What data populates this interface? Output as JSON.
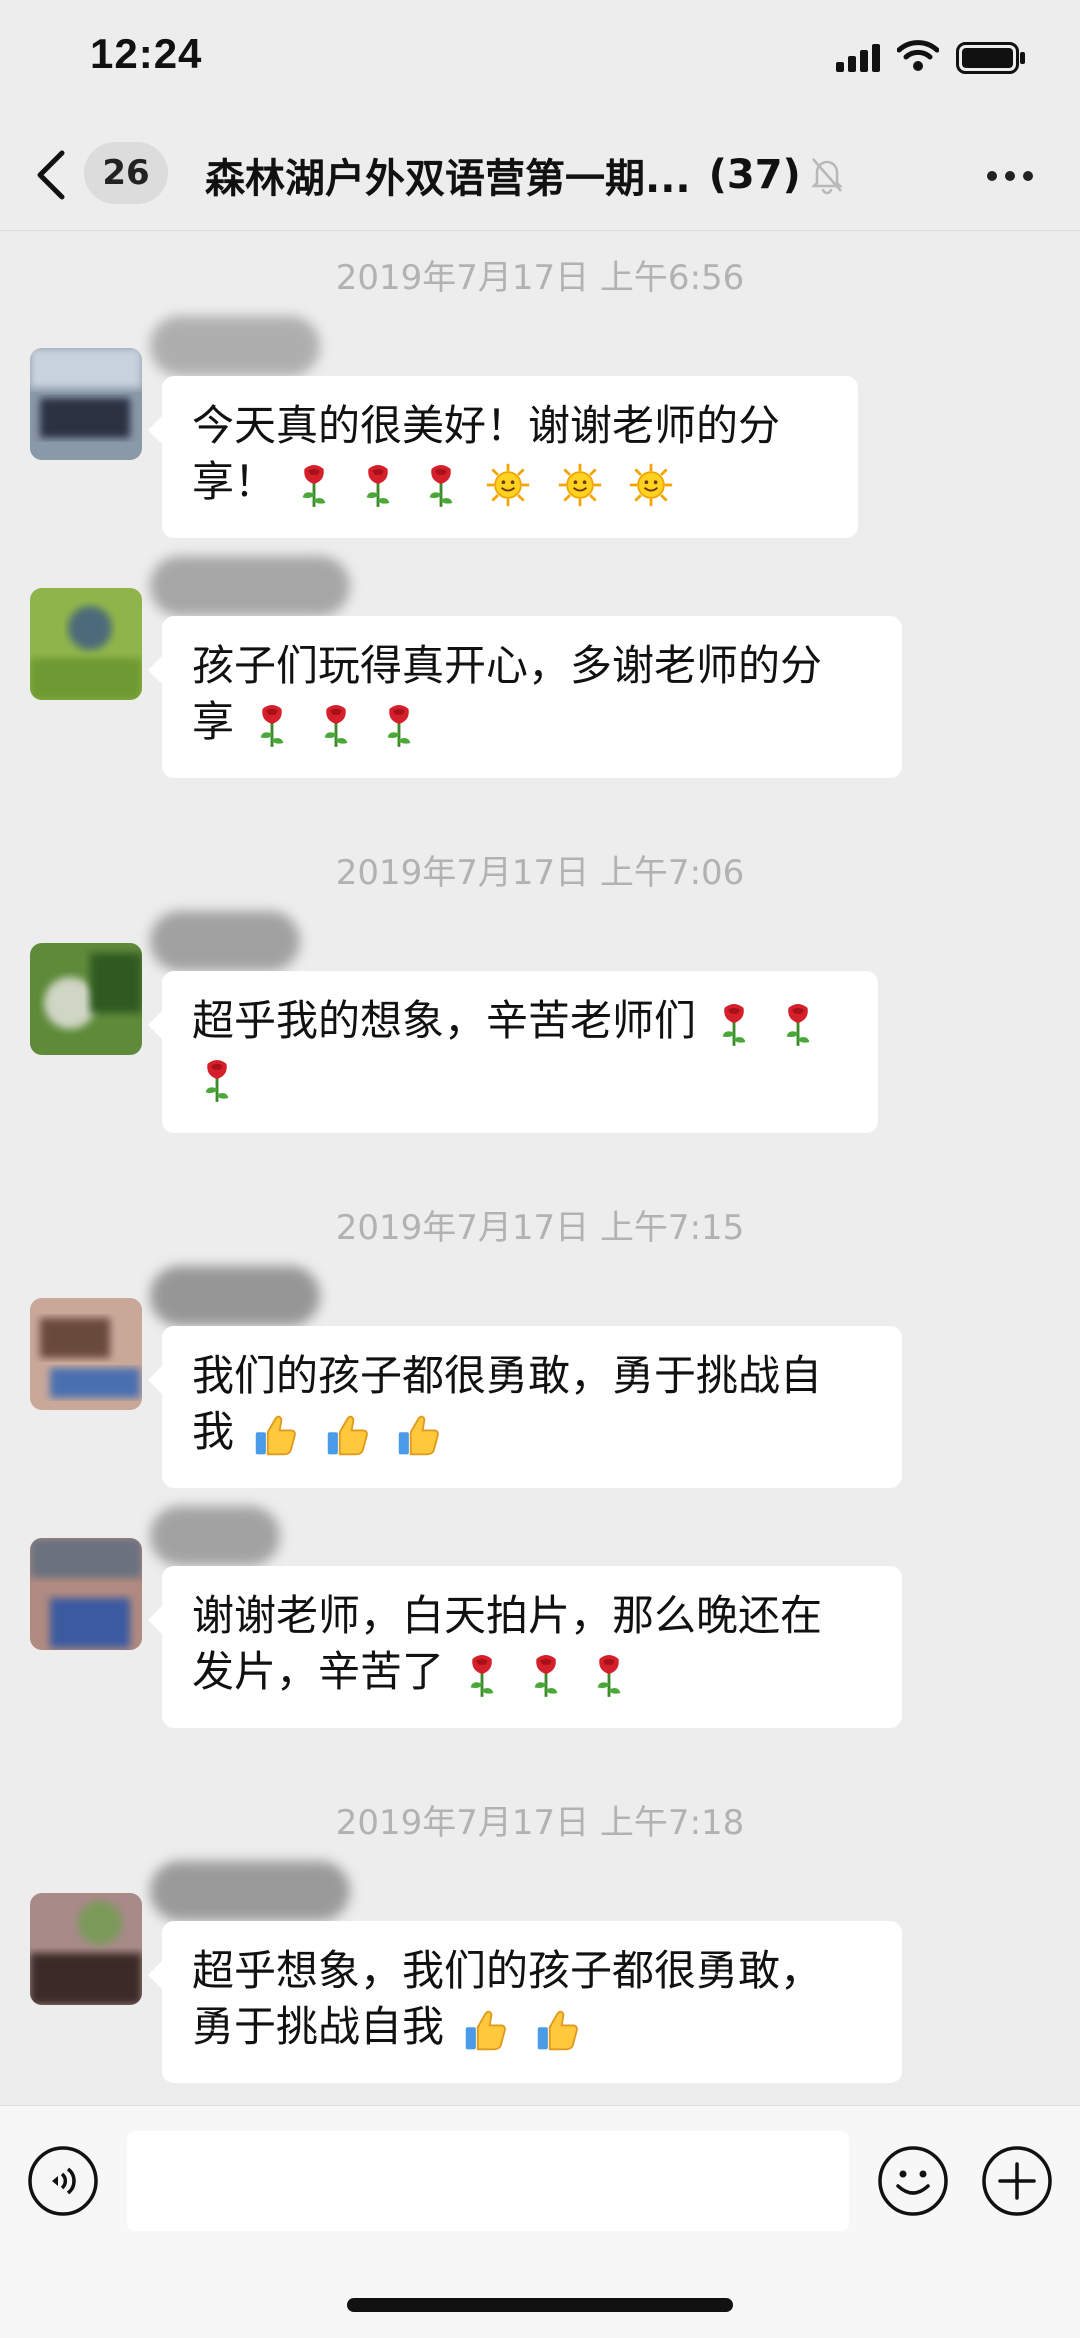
{
  "status_bar": {
    "time": "12:24"
  },
  "nav": {
    "unread_count": "26",
    "title": "森林湖户外双语营第一期...",
    "member_count": "(37)"
  },
  "timestamps": [
    "2019年7月17日 上午6:56",
    "2019年7月17日 上午7:06",
    "2019年7月17日 上午7:15",
    "2019年7月17日 上午7:18"
  ],
  "messages": [
    {
      "line1": "今天真的很美好！谢谢老师的分",
      "line2": "享！",
      "emojis": [
        "rose",
        "rose",
        "rose",
        "sun",
        "sun",
        "sun"
      ]
    },
    {
      "line1": "孩子们玩得真开心，多谢老师的分",
      "line2": "享",
      "emojis": [
        "rose",
        "rose",
        "rose"
      ]
    },
    {
      "line1": "超乎我的想象，辛苦老师们",
      "line2": "",
      "emojis": [
        "rose",
        "rose",
        "rose"
      ]
    },
    {
      "line1": "我们的孩子都很勇敢，勇于挑战自",
      "line2": "我",
      "emojis": [
        "thumbs-up",
        "thumbs-up",
        "thumbs-up"
      ]
    },
    {
      "line1": "谢谢老师，白天拍片，那么晚还在",
      "line2": "发片，辛苦了",
      "emojis": [
        "rose",
        "rose",
        "rose"
      ]
    },
    {
      "line1": "超乎想象，我们的孩子都很勇敢，",
      "line2": "勇于挑战自我",
      "emojis": [
        "thumbs-up",
        "thumbs-up"
      ]
    }
  ],
  "input": {
    "value": "",
    "placeholder": ""
  },
  "colors": {
    "background": "#ededed",
    "bubble": "#ffffff",
    "timestamp_text": "#b2b2b2"
  }
}
